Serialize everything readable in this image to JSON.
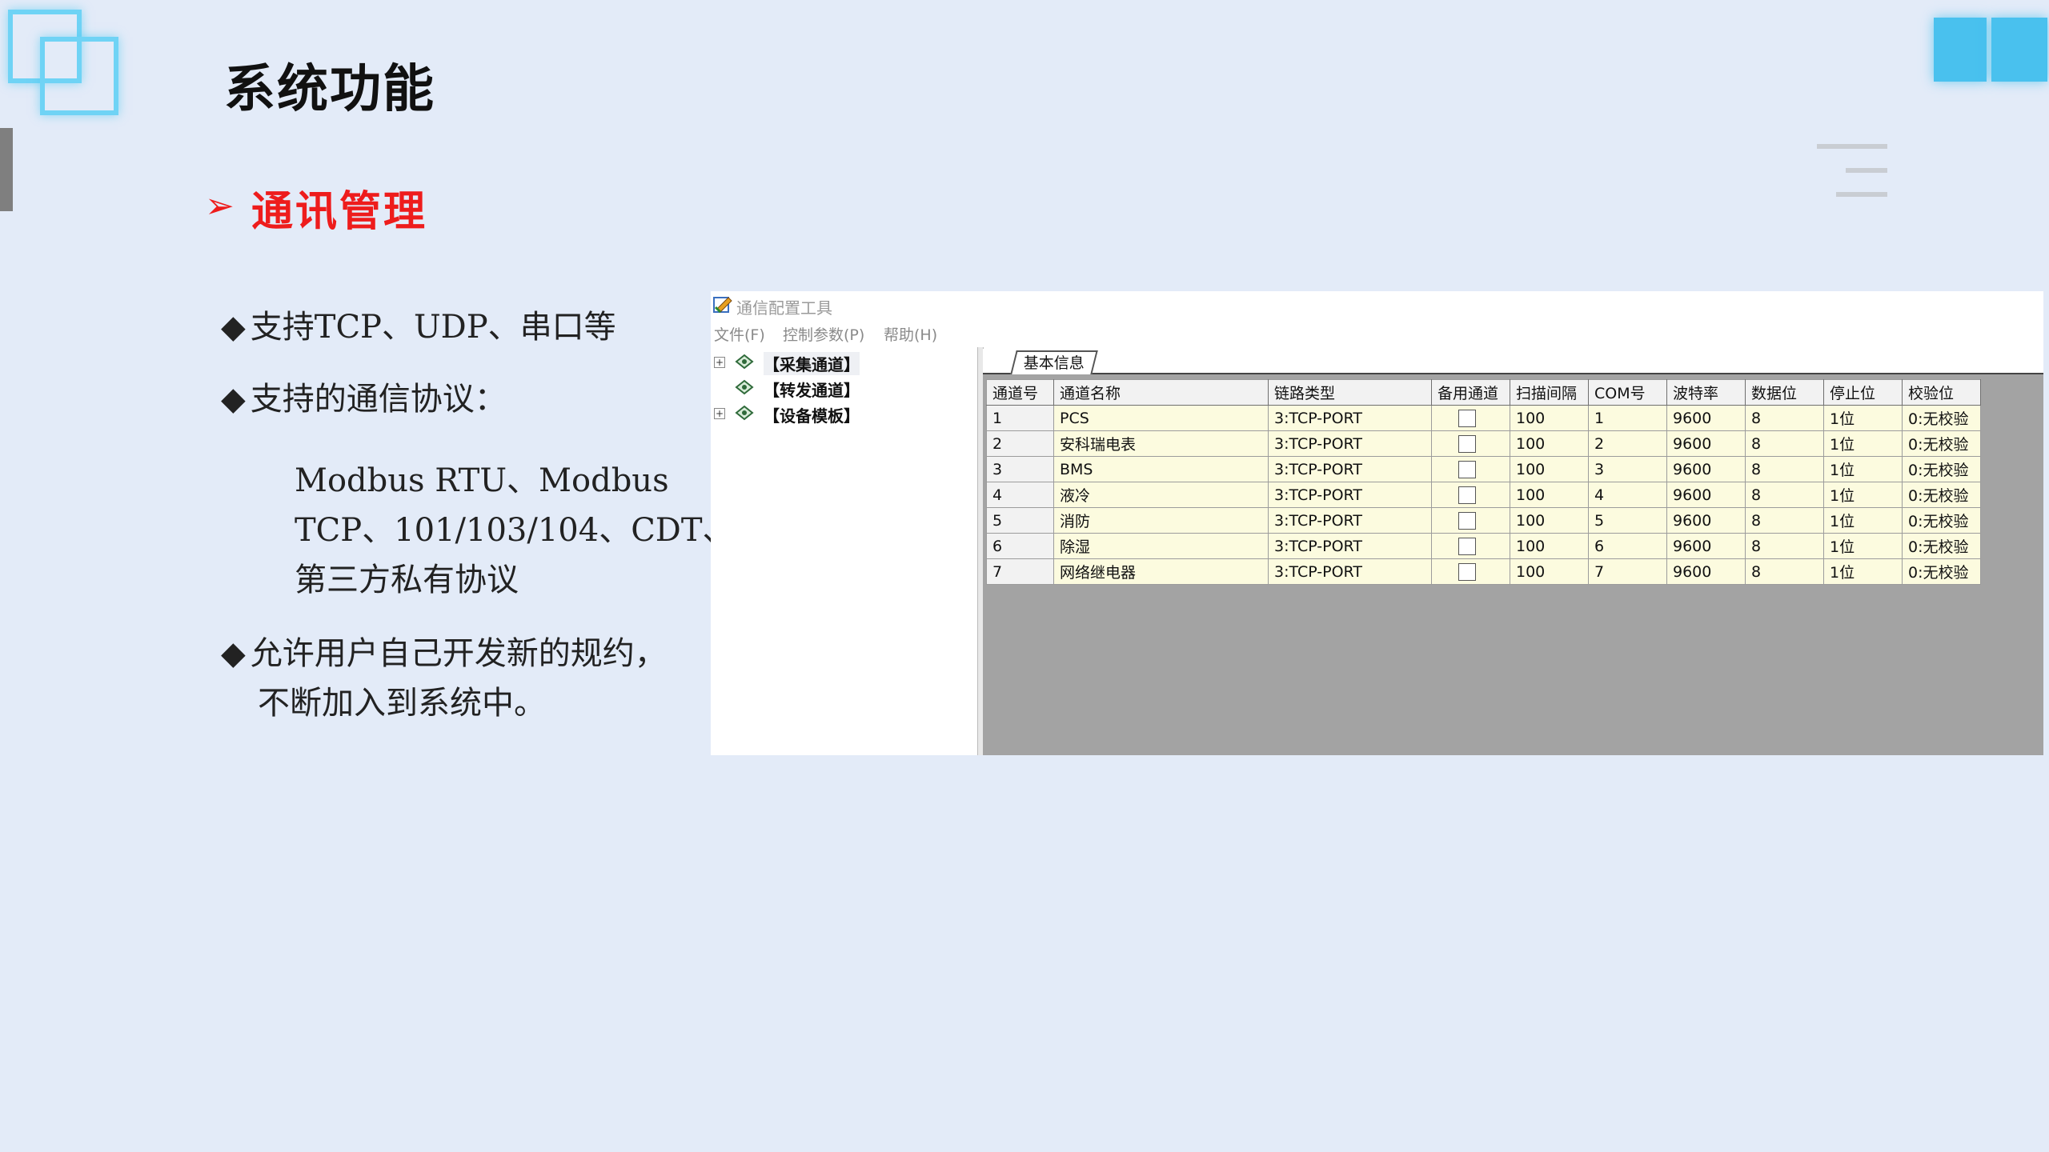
{
  "page": {
    "title": "系统功能",
    "section_title": "通讯管理",
    "bullets": [
      {
        "text": "支持TCP、UDP、串口等"
      },
      {
        "text": "支持的通信协议："
      },
      {
        "lines": [
          "Modbus  RTU、Modbus",
          "TCP、101/103/104、CDT、",
          "第三方私有协议"
        ]
      },
      {
        "lines": [
          "允许用户自己开发新的规约，",
          "不断加入到系统中。"
        ]
      }
    ],
    "bullet_glyph": "◆",
    "section_glyph": "➢"
  },
  "app": {
    "title": "通信配置工具",
    "menu": [
      "文件(F)",
      "控制参数(P)",
      "帮助(H)"
    ],
    "tree": [
      {
        "label": "【采集通道】",
        "expander": "+"
      },
      {
        "label": "【转发通道】",
        "expander": ""
      },
      {
        "label": "【设备模板】",
        "expander": "+"
      }
    ],
    "tab": "基本信息",
    "columns": [
      "通道号",
      "通道名称",
      "链路类型",
      "备用通道",
      "扫描间隔",
      "COM号",
      "波特率",
      "数据位",
      "停止位",
      "校验位"
    ],
    "rows": [
      [
        "1",
        "PCS",
        "3:TCP-PORT",
        "",
        "100",
        "1",
        "9600",
        "8",
        "1位",
        "0:无校验"
      ],
      [
        "2",
        "安科瑞电表",
        "3:TCP-PORT",
        "",
        "100",
        "2",
        "9600",
        "8",
        "1位",
        "0:无校验"
      ],
      [
        "3",
        "BMS",
        "3:TCP-PORT",
        "",
        "100",
        "3",
        "9600",
        "8",
        "1位",
        "0:无校验"
      ],
      [
        "4",
        "液冷",
        "3:TCP-PORT",
        "",
        "100",
        "4",
        "9600",
        "8",
        "1位",
        "0:无校验"
      ],
      [
        "5",
        "消防",
        "3:TCP-PORT",
        "",
        "100",
        "5",
        "9600",
        "8",
        "1位",
        "0:无校验"
      ],
      [
        "6",
        "除湿",
        "3:TCP-PORT",
        "",
        "100",
        "6",
        "9600",
        "8",
        "1位",
        "0:无校验"
      ],
      [
        "7",
        "网络继电器",
        "3:TCP-PORT",
        "",
        "100",
        "7",
        "9600",
        "8",
        "1位",
        "0:无校验"
      ]
    ]
  },
  "colors": {
    "background": "#e3ebf8",
    "accent_red": "#ee1c1c",
    "accent_cyan": "#49c1ee",
    "grid_cell": "#fcfbdf",
    "grid_empty": "#a3a3a3"
  }
}
